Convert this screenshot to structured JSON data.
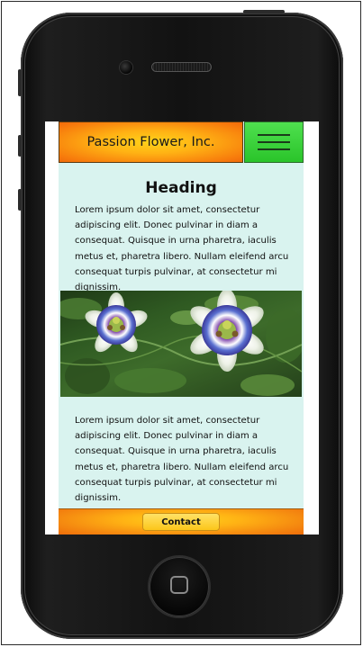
{
  "header": {
    "brand": "Passion Flower, Inc."
  },
  "content": {
    "heading": "Heading",
    "paragraph_1": "Lorem ipsum dolor sit amet, consectetur adipiscing elit. Donec pulvinar in diam a consequat. Quisque in urna pharetra, iaculis metus et, pharetra libero. Nullam eleifend arcu consequat turpis pulvinar, at consectetur mi dignissim.",
    "paragraph_2": "Lorem ipsum dolor sit amet, consectetur adipiscing elit. Donec pulvinar in diam a consequat. Quisque in urna pharetra, iaculis metus et, pharetra libero. Nullam eleifend arcu consequat turpis pulvinar, at consectetur mi dignissim."
  },
  "footer": {
    "contact_label": "Contact"
  },
  "colors": {
    "header_orange": "#f77b0c",
    "header_yellow": "#ffd21a",
    "menu_green": "#2ac42a",
    "content_bg": "#d9f3ef",
    "phone_body": "#121212"
  },
  "icons": {
    "menu": "hamburger-icon",
    "home": "home-square-icon"
  }
}
